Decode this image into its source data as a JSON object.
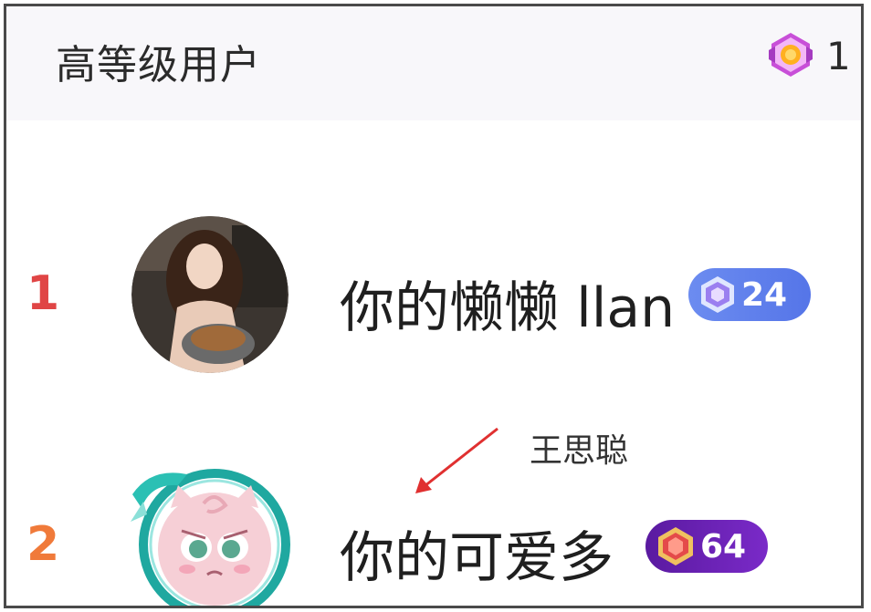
{
  "header": {
    "title": "高等级用户",
    "count": "1",
    "badge_icon": "crown-gem-icon"
  },
  "users": [
    {
      "rank": "1",
      "name": "你的懒懒 llan",
      "level": "24",
      "badge_color": "#5a7cec"
    },
    {
      "rank": "2",
      "name": "你的可爱多",
      "level": "64",
      "badge_color": "#6a22b4"
    }
  ],
  "annotation": {
    "text": "王思聪"
  }
}
